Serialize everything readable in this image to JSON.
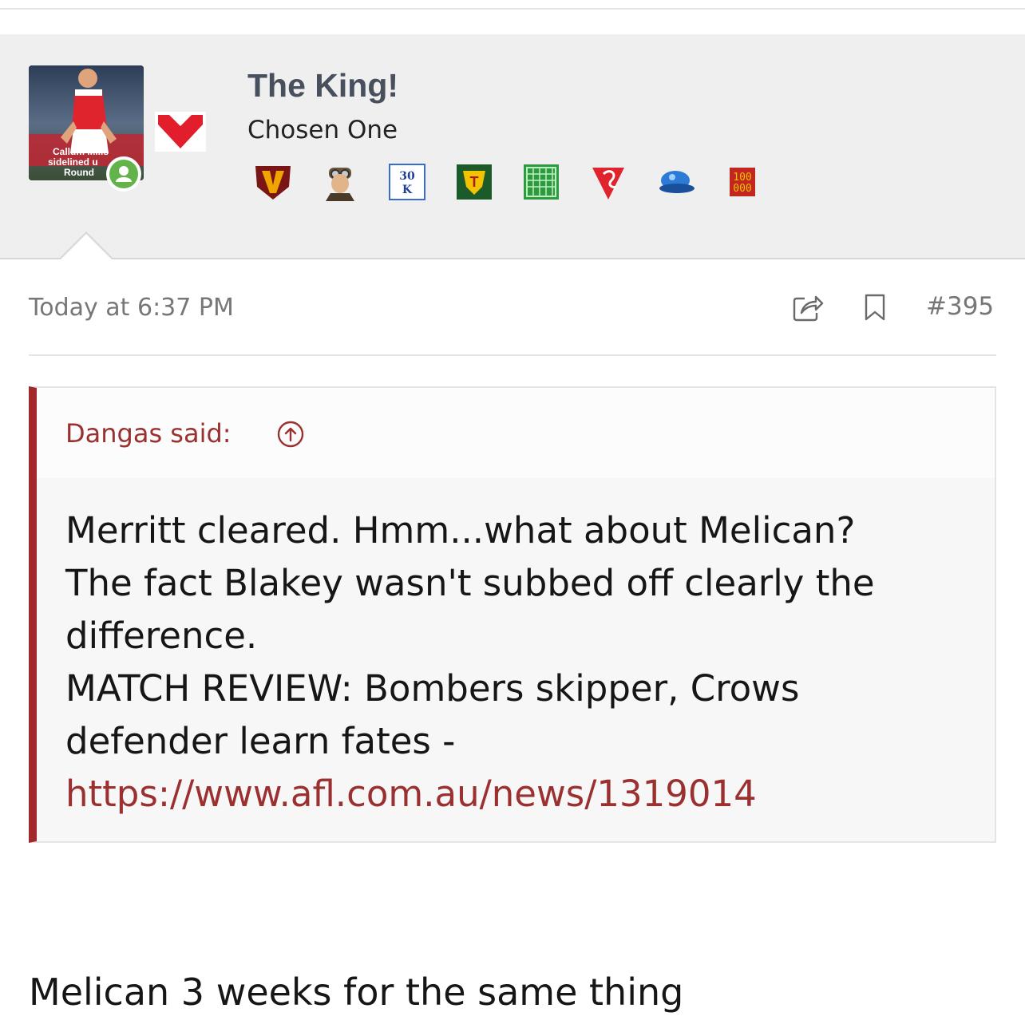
{
  "post": {
    "user": {
      "username": "The King!",
      "user_title": "Chosen One",
      "avatar_caption": [
        "Callum Mills",
        "sidelined u",
        "Round"
      ],
      "online": true,
      "trophies": [
        {
          "icon": "v-shield-trophy-icon"
        },
        {
          "icon": "aviator-trophy-icon"
        },
        {
          "icon": "30k-trophy-icon",
          "text": "30 K"
        },
        {
          "icon": "tasmania-trophy-icon",
          "text": "T"
        },
        {
          "icon": "green-net-trophy-icon"
        },
        {
          "icon": "swans-logo-trophy-icon"
        },
        {
          "icon": "blue-cap-trophy-icon"
        },
        {
          "icon": "100000-trophy-icon",
          "text": "100 000"
        }
      ]
    },
    "date": "Today at 6:37 PM",
    "number": "#395",
    "quote": {
      "author": "Dangas said:",
      "lines": [
        "Merritt cleared. Hmm...what about Melican?",
        "The fact Blakey wasn't subbed off clearly the",
        "difference.",
        "MATCH REVIEW: Bombers skipper, Crows",
        "defender learn fates -"
      ],
      "link": "https://www.afl.com.au/news/1319014"
    },
    "reply": "Melican 3 weeks for the same thing"
  },
  "colors": {
    "accent": "#a3282c",
    "link": "#9b3030",
    "online": "#63b34b",
    "header_bg": "#efefef"
  }
}
